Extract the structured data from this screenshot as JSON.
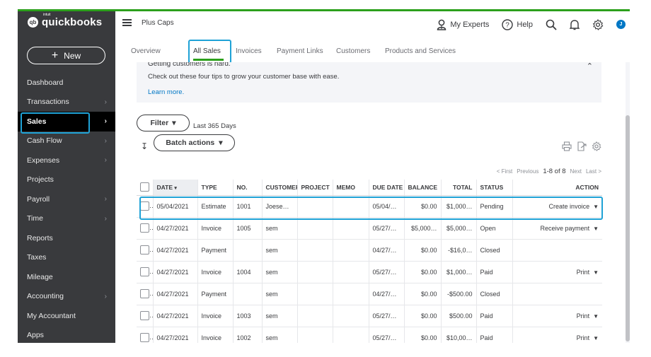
{
  "brand": {
    "logo_mark": "qb",
    "intuit": "intuit",
    "name": "quickbooks"
  },
  "sidebar": {
    "new_label": "New",
    "items": [
      {
        "label": "Dashboard",
        "chevron": false
      },
      {
        "label": "Transactions",
        "chevron": true
      },
      {
        "label": "Sales",
        "chevron": true,
        "active": true
      },
      {
        "label": "Cash Flow",
        "chevron": true
      },
      {
        "label": "Expenses",
        "chevron": true
      },
      {
        "label": "Projects",
        "chevron": false
      },
      {
        "label": "Payroll",
        "chevron": true
      },
      {
        "label": "Time",
        "chevron": true
      },
      {
        "label": "Reports",
        "chevron": false
      },
      {
        "label": "Taxes",
        "chevron": false
      },
      {
        "label": "Mileage",
        "chevron": false
      },
      {
        "label": "Accounting",
        "chevron": true
      },
      {
        "label": "My Accountant",
        "chevron": false
      },
      {
        "label": "Apps",
        "chevron": false
      }
    ]
  },
  "header": {
    "company": "Plus Caps",
    "my_experts": "My Experts",
    "help": "Help",
    "avatar_initial": "J"
  },
  "tabs": [
    "Overview",
    "All Sales",
    "Invoices",
    "Payment Links",
    "Customers",
    "Products and Services"
  ],
  "active_tab": "All Sales",
  "tip": {
    "title": "Getting customers is hard.",
    "body": "Check out these four tips to grow your customer base with ease.",
    "link": "Learn more."
  },
  "toolbar": {
    "filter_label": "Filter",
    "range_label": "Last 365 Days",
    "batch_label": "Batch actions"
  },
  "pager": {
    "first": "< First",
    "previous": "Previous",
    "count": "1-8 of 8",
    "next": "Next",
    "last": "Last >"
  },
  "table": {
    "columns": [
      "",
      "DATE",
      "TYPE",
      "NO.",
      "CUSTOMER",
      "PROJECT",
      "MEMO",
      "DUE DATE",
      "BALANCE",
      "TOTAL",
      "STATUS",
      "ACTION"
    ],
    "rows": [
      {
        "date": "05/04/2021",
        "type": "Estimate",
        "no": "1001",
        "customer": "Joese…",
        "project": "",
        "memo": "",
        "due": "05/04/…",
        "balance": "$0.00",
        "total": "$1,000…",
        "status": "Pending",
        "action": "Create invoice",
        "status_class": ""
      },
      {
        "date": "04/27/2021",
        "type": "Invoice",
        "no": "1005",
        "customer": "sem",
        "project": "",
        "memo": "",
        "due": "05/27/…",
        "balance": "$5,000…",
        "total": "$5,000…",
        "status": "Open",
        "action": "Receive payment",
        "status_class": ""
      },
      {
        "date": "04/27/2021",
        "type": "Payment",
        "no": "",
        "customer": "sem",
        "project": "",
        "memo": "",
        "due": "04/27/…",
        "balance": "$0.00",
        "total": "-$16,0…",
        "status": "Closed",
        "action": "",
        "status_class": "status-closed"
      },
      {
        "date": "04/27/2021",
        "type": "Invoice",
        "no": "1004",
        "customer": "sem",
        "project": "",
        "memo": "",
        "due": "05/27/…",
        "balance": "$0.00",
        "total": "$1,000…",
        "status": "Paid",
        "action": "Print",
        "status_class": "status-paid"
      },
      {
        "date": "04/27/2021",
        "type": "Payment",
        "no": "",
        "customer": "sem",
        "project": "",
        "memo": "",
        "due": "04/27/…",
        "balance": "$0.00",
        "total": "-$500.00",
        "status": "Closed",
        "action": "",
        "status_class": "status-closed"
      },
      {
        "date": "04/27/2021",
        "type": "Invoice",
        "no": "1003",
        "customer": "sem",
        "project": "",
        "memo": "",
        "due": "05/27/…",
        "balance": "$0.00",
        "total": "$500.00",
        "status": "Paid",
        "action": "Print",
        "status_class": "status-paid"
      },
      {
        "date": "04/27/2021",
        "type": "Invoice",
        "no": "1002",
        "customer": "sem",
        "project": "",
        "memo": "",
        "due": "05/27/…",
        "balance": "$0.00",
        "total": "$10,00…",
        "status": "Paid",
        "action": "Print",
        "status_class": "status-paid"
      },
      {
        "date": "04/27/2021",
        "type": "Invoice",
        "no": "1001",
        "customer": "sem",
        "project": "",
        "memo": "",
        "due": "05/27/…",
        "balance": "$0.00",
        "total": "$1,000…",
        "status": "Paid",
        "action": "Print",
        "status_class": "status-paid"
      }
    ]
  },
  "colors": {
    "sidebar_bg": "#393a3d",
    "accent_green": "#2ca01c",
    "link_blue": "#0077c5",
    "highlight": "#1fa2d6"
  }
}
